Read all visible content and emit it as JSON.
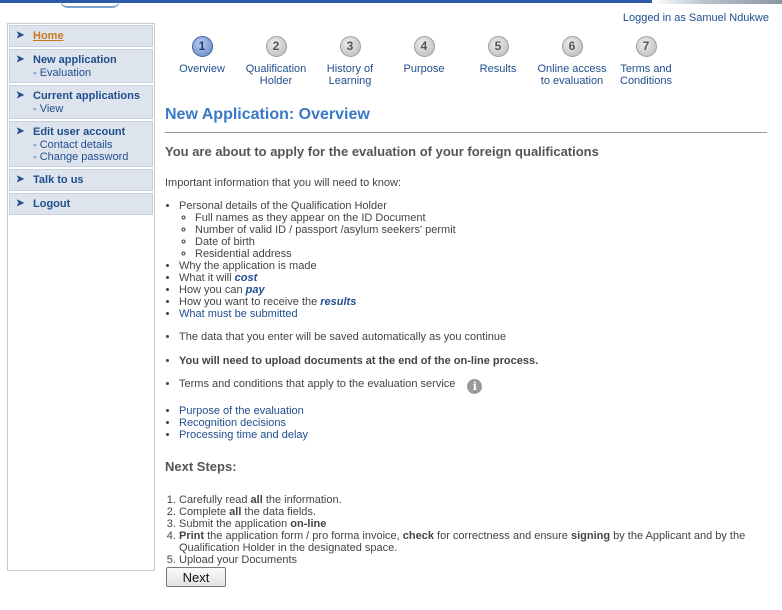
{
  "header": {
    "logged_in": "Logged in as Samuel Ndukwe"
  },
  "sidebar": {
    "items": [
      {
        "label": "Home",
        "subs": []
      },
      {
        "label": "New application",
        "subs": [
          "- Evaluation"
        ]
      },
      {
        "label": "Current applications",
        "subs": [
          "- View"
        ]
      },
      {
        "label": "Edit user account",
        "subs": [
          "- Contact details",
          "- Change password"
        ]
      },
      {
        "label": "Talk to us",
        "subs": []
      },
      {
        "label": "Logout",
        "subs": []
      }
    ]
  },
  "steps": [
    {
      "num": "1",
      "line1": "Overview",
      "line2": ""
    },
    {
      "num": "2",
      "line1": "Qualification",
      "line2": "Holder"
    },
    {
      "num": "3",
      "line1": "History of",
      "line2": "Learning"
    },
    {
      "num": "4",
      "line1": "Purpose",
      "line2": ""
    },
    {
      "num": "5",
      "line1": "Results",
      "line2": ""
    },
    {
      "num": "6",
      "line1": "Online access",
      "line2": "to evaluation"
    },
    {
      "num": "7",
      "line1": "Terms and",
      "line2": "Conditions"
    }
  ],
  "content": {
    "title": "New Application: Overview",
    "subtitle": "You are about to apply for the evaluation of your foreign qualifications",
    "intro": "Important information that you will need to know:",
    "personal": "Personal details of the Qualification Holder",
    "personal_items": [
      "Full names as they appear on the ID Document",
      "Number of valid ID / passport /asylum seekers' permit",
      "Date of birth",
      "Residential address"
    ],
    "why": "Why the application is made",
    "cost_pre": "What it will ",
    "cost_em": "cost",
    "pay_pre": "How you can ",
    "pay_em": "pay",
    "results_pre": "How you want to receive the ",
    "results_em": "results",
    "submitted": "What must be submitted",
    "saved": "The data that you enter will be saved automatically as you continue",
    "upload_note": "You will need to upload documents at the end of the on-line process.",
    "terms": "Terms and conditions that apply to the evaluation service",
    "info_glyph": "i",
    "links": [
      "Purpose of the evaluation",
      "Recognition decisions",
      "Processing time and delay"
    ],
    "next_steps_title": "Next Steps:",
    "steps": {
      "s1_a": "Carefully read ",
      "s1_b": "all",
      "s1_c": " the information.",
      "s2_a": "Complete ",
      "s2_b": "all",
      "s2_c": " the data fields.",
      "s3_a": "Submit the application ",
      "s3_b": "on-line",
      "s4_a": "Print",
      "s4_b": " the application form / pro forma invoice, ",
      "s4_c": "check",
      "s4_d": " for correctness and ensure ",
      "s4_e": "signing",
      "s4_f": " by the Applicant and by the Qualification Holder in the designated space.",
      "s5": "Upload your Documents"
    },
    "next_button": "Next"
  },
  "colors": {
    "link": "#1f4e8c",
    "title": "#3a79c8",
    "home_active": "#c8791c",
    "nav_bg": "#dde4ee"
  }
}
